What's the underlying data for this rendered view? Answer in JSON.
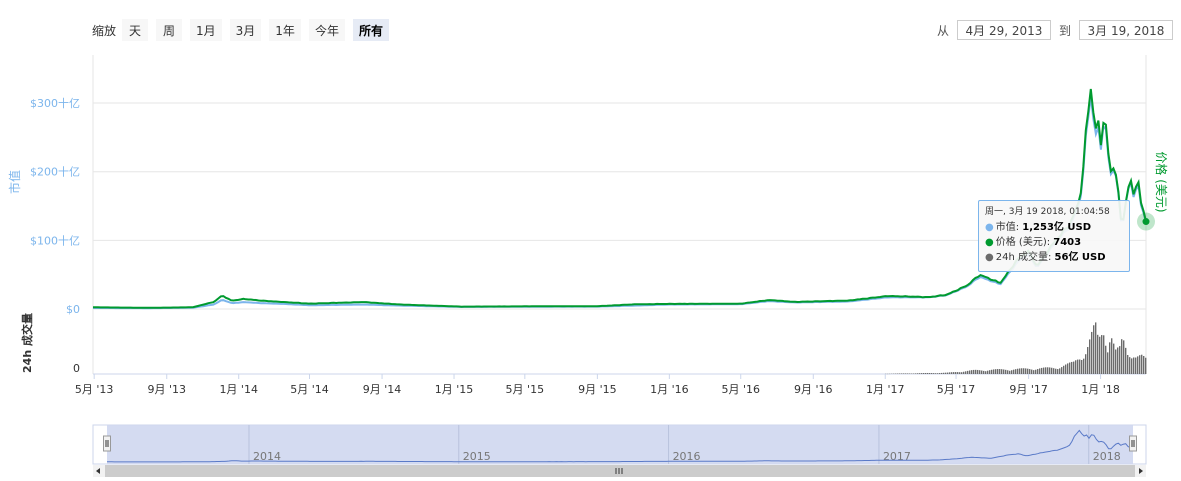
{
  "zoom": {
    "label": "缩放",
    "buttons": [
      {
        "label": "天",
        "active": false
      },
      {
        "label": "周",
        "active": false
      },
      {
        "label": "1月",
        "active": false
      },
      {
        "label": "3月",
        "active": false
      },
      {
        "label": "1年",
        "active": false
      },
      {
        "label": "今年",
        "active": false
      },
      {
        "label": "所有",
        "active": true
      }
    ]
  },
  "range": {
    "from_label": "从",
    "from_value": "4月 29, 2013",
    "to_label": "到",
    "to_value": "3月 19, 2018"
  },
  "tooltip": {
    "date": "周一, 3月 19 2018, 01:04:58",
    "market_cap_label": "市值: ",
    "market_cap_value": "1,253亿 USD",
    "price_label": "价格 (美元): ",
    "price_value": "7403",
    "volume_label": "24h 成交量: ",
    "volume_value": "56亿 USD"
  },
  "colors": {
    "market_cap": "#7cb5ec",
    "price": "#009a2f",
    "volume": "#6b6b6b",
    "navigator_fill": "#cfd7ef",
    "navigator_line": "#5a7ac8"
  },
  "chart_data": {
    "type": "line",
    "x_start": "2013-04-29",
    "x_end": "2018-03-19",
    "left_axis": {
      "label": "市值",
      "ticks": [
        0,
        100,
        200,
        300
      ],
      "tick_labels": [
        "$0",
        "$100十亿",
        "$200十亿",
        "$300十亿"
      ],
      "range": [
        0,
        370
      ]
    },
    "right_axis": {
      "label": "价格 (美元)",
      "range": [
        0,
        21500
      ]
    },
    "volume_axis": {
      "label": "24h 成交量",
      "tick_labels": [
        "0"
      ],
      "range": [
        0,
        22
      ]
    },
    "x_tick_labels": [
      "5月 '13",
      "9月 '13",
      "1月 '14",
      "5月 '14",
      "9月 '14",
      "1月 '15",
      "5月 '15",
      "9月 '15",
      "1月 '16",
      "5月 '16",
      "9月 '16",
      "1月 '17",
      "5月 '17",
      "9月 '17",
      "1月 '18"
    ],
    "x_tick_dates": [
      "2013-05-01",
      "2013-09-01",
      "2014-01-01",
      "2014-05-01",
      "2014-09-01",
      "2015-01-01",
      "2015-05-01",
      "2015-09-01",
      "2016-01-01",
      "2016-05-01",
      "2016-09-01",
      "2017-01-01",
      "2017-05-01",
      "2017-09-01",
      "2018-01-01"
    ],
    "navigator_labels": [
      "2014",
      "2015",
      "2016",
      "2017",
      "2018"
    ],
    "navigator_dates": [
      "2014-01-01",
      "2015-01-01",
      "2016-01-01",
      "2017-01-01",
      "2018-01-01"
    ],
    "grid": true,
    "series": [
      {
        "name": "市值",
        "axis": "left",
        "points": [
          [
            "2013-04-29",
            1.5
          ],
          [
            "2013-08-01",
            1.2
          ],
          [
            "2013-10-15",
            1.8
          ],
          [
            "2013-11-20",
            6.5
          ],
          [
            "2013-12-04",
            13.5
          ],
          [
            "2013-12-20",
            8.5
          ],
          [
            "2014-01-10",
            10.0
          ],
          [
            "2014-02-10",
            8.5
          ],
          [
            "2014-03-15",
            7.5
          ],
          [
            "2014-05-01",
            5.5
          ],
          [
            "2014-08-01",
            6.5
          ],
          [
            "2014-10-01",
            5.0
          ],
          [
            "2015-01-15",
            3.0
          ],
          [
            "2015-06-01",
            3.4
          ],
          [
            "2015-09-01",
            3.5
          ],
          [
            "2015-11-05",
            5.0
          ],
          [
            "2016-01-01",
            6.5
          ],
          [
            "2016-05-01",
            7.0
          ],
          [
            "2016-06-18",
            11.5
          ],
          [
            "2016-08-01",
            9.5
          ],
          [
            "2016-11-01",
            11.0
          ],
          [
            "2017-01-05",
            17.0
          ],
          [
            "2017-02-15",
            17.0
          ],
          [
            "2017-03-15",
            17.0
          ],
          [
            "2017-04-15",
            20.0
          ],
          [
            "2017-05-20",
            33.0
          ],
          [
            "2017-06-10",
            47.0
          ],
          [
            "2017-07-15",
            36.0
          ],
          [
            "2017-08-15",
            70.0
          ],
          [
            "2017-09-01",
            80.0
          ],
          [
            "2017-09-15",
            60.0
          ],
          [
            "2017-10-15",
            95.0
          ],
          [
            "2017-11-10",
            120.0
          ],
          [
            "2017-11-25",
            150.0
          ],
          [
            "2017-12-01",
            180.0
          ],
          [
            "2017-12-08",
            260.0
          ],
          [
            "2017-12-17",
            320.0
          ],
          [
            "2017-12-22",
            245.0
          ],
          [
            "2017-12-27",
            270.0
          ],
          [
            "2018-01-01",
            230.0
          ],
          [
            "2018-01-07",
            280.0
          ],
          [
            "2018-01-12",
            245.0
          ],
          [
            "2018-01-17",
            190.0
          ],
          [
            "2018-01-21",
            205.0
          ],
          [
            "2018-01-28",
            195.0
          ],
          [
            "2018-02-02",
            150.0
          ],
          [
            "2018-02-06",
            115.0
          ],
          [
            "2018-02-12",
            150.0
          ],
          [
            "2018-02-20",
            190.0
          ],
          [
            "2018-02-26",
            160.0
          ],
          [
            "2018-03-05",
            190.0
          ],
          [
            "2018-03-10",
            150.0
          ],
          [
            "2018-03-15",
            140.0
          ],
          [
            "2018-03-19",
            125.3
          ]
        ]
      },
      {
        "name": "价格 (美元)",
        "axis": "right",
        "points": [
          [
            "2013-04-29",
            144
          ],
          [
            "2013-08-01",
            100
          ],
          [
            "2013-10-15",
            145
          ],
          [
            "2013-11-20",
            600
          ],
          [
            "2013-12-04",
            1150
          ],
          [
            "2013-12-20",
            700
          ],
          [
            "2014-01-10",
            850
          ],
          [
            "2014-02-10",
            700
          ],
          [
            "2014-03-15",
            600
          ],
          [
            "2014-05-01",
            450
          ],
          [
            "2014-08-01",
            590
          ],
          [
            "2014-10-01",
            380
          ],
          [
            "2015-01-15",
            200
          ],
          [
            "2015-06-01",
            230
          ],
          [
            "2015-09-01",
            235
          ],
          [
            "2015-11-05",
            400
          ],
          [
            "2016-01-01",
            430
          ],
          [
            "2016-05-01",
            450
          ],
          [
            "2016-06-18",
            760
          ],
          [
            "2016-08-01",
            600
          ],
          [
            "2016-11-01",
            720
          ],
          [
            "2017-01-05",
            1100
          ],
          [
            "2017-02-15",
            1050
          ],
          [
            "2017-03-15",
            1000
          ],
          [
            "2017-04-15",
            1200
          ],
          [
            "2017-05-20",
            2000
          ],
          [
            "2017-06-10",
            2900
          ],
          [
            "2017-07-15",
            2200
          ],
          [
            "2017-08-15",
            4300
          ],
          [
            "2017-09-01",
            4900
          ],
          [
            "2017-09-15",
            3600
          ],
          [
            "2017-10-15",
            5700
          ],
          [
            "2017-11-10",
            7200
          ],
          [
            "2017-11-25",
            9000
          ],
          [
            "2017-12-01",
            10800
          ],
          [
            "2017-12-08",
            15500
          ],
          [
            "2017-12-17",
            19300
          ],
          [
            "2017-12-22",
            14700
          ],
          [
            "2017-12-27",
            16200
          ],
          [
            "2018-01-01",
            13800
          ],
          [
            "2018-01-07",
            16600
          ],
          [
            "2018-01-12",
            14600
          ],
          [
            "2018-01-17",
            11300
          ],
          [
            "2018-01-21",
            12100
          ],
          [
            "2018-01-28",
            11500
          ],
          [
            "2018-02-02",
            8800
          ],
          [
            "2018-02-06",
            6800
          ],
          [
            "2018-02-12",
            8800
          ],
          [
            "2018-02-20",
            11200
          ],
          [
            "2018-02-26",
            9500
          ],
          [
            "2018-03-05",
            11400
          ],
          [
            "2018-03-10",
            8900
          ],
          [
            "2018-03-15",
            8300
          ],
          [
            "2018-03-19",
            7403
          ]
        ]
      },
      {
        "name": "24h 成交量",
        "axis": "volume",
        "points": [
          [
            "2013-04-29",
            0
          ],
          [
            "2017-01-01",
            0.1
          ],
          [
            "2017-04-15",
            0.5
          ],
          [
            "2017-06-01",
            1.5
          ],
          [
            "2017-08-15",
            2.0
          ],
          [
            "2017-10-15",
            2.5
          ],
          [
            "2017-11-15",
            4.5
          ],
          [
            "2017-12-05",
            9.0
          ],
          [
            "2017-12-15",
            15.0
          ],
          [
            "2017-12-22",
            19.0
          ],
          [
            "2017-12-27",
            13.0
          ],
          [
            "2018-01-05",
            18.0
          ],
          [
            "2018-01-12",
            12.0
          ],
          [
            "2018-01-17",
            17.0
          ],
          [
            "2018-01-25",
            9.0
          ],
          [
            "2018-02-02",
            10.0
          ],
          [
            "2018-02-06",
            14.0
          ],
          [
            "2018-02-15",
            8.5
          ],
          [
            "2018-02-22",
            9.0
          ],
          [
            "2018-03-01",
            7.0
          ],
          [
            "2018-03-10",
            7.0
          ],
          [
            "2018-03-19",
            5.6
          ]
        ]
      }
    ]
  }
}
